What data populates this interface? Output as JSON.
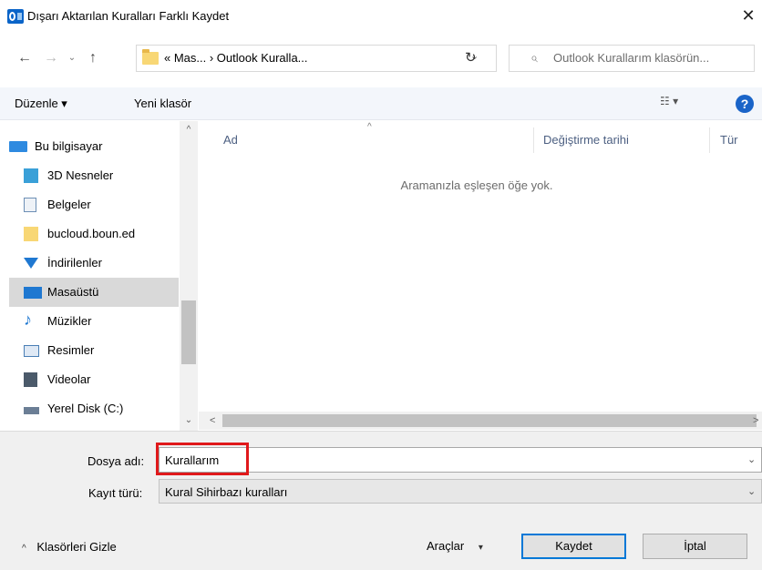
{
  "window": {
    "title": "Dışarı Aktarılan Kuralları Farklı Kaydet",
    "close_glyph": "✕"
  },
  "nav": {
    "back_glyph": "←",
    "forward_glyph": "→",
    "recent_glyph": "⌄",
    "up_glyph": "↑",
    "address": "« Mas...  ›  Outlook Kuralla...",
    "address_dropdown": "⌄",
    "refresh_glyph": "↻",
    "search_glyph": "⌕",
    "search_placeholder": "Outlook Kurallarım klasörün..."
  },
  "toolbar": {
    "organize_label": "Düzenle ▾",
    "new_folder_label": "Yeni klasör",
    "view_glyph": "☷ ▾",
    "help_glyph": "?"
  },
  "sidebar": {
    "items": [
      {
        "label": "Bu bilgisayar",
        "icon": "computer-icon",
        "color": "#2e8ae0"
      },
      {
        "label": "3D Nesneler",
        "icon": "cube-icon",
        "color": "#3aa0d8"
      },
      {
        "label": "Belgeler",
        "icon": "document-icon",
        "color": "#6d8fb5"
      },
      {
        "label": "bucloud.boun.ed",
        "icon": "folder-icon",
        "color": "#f8d775"
      },
      {
        "label": "İndirilenler",
        "icon": "download-icon",
        "color": "#1f78d1"
      },
      {
        "label": "Masaüstü",
        "icon": "desktop-icon",
        "color": "#1f78d1"
      },
      {
        "label": "Müzikler",
        "icon": "music-icon",
        "color": "#1f78d1"
      },
      {
        "label": "Resimler",
        "icon": "pictures-icon",
        "color": "#4a7fb5"
      },
      {
        "label": "Videolar",
        "icon": "film-icon",
        "color": "#4b5a6a"
      },
      {
        "label": "Yerel Disk (C:)",
        "icon": "drive-icon",
        "color": "#6b7e95"
      }
    ],
    "selected": "Masaüstü"
  },
  "list": {
    "columns": [
      "Ad",
      "Değiştirme tarihi",
      "Tür"
    ],
    "empty_message": "Aramanızla eşleşen öğe yok."
  },
  "form": {
    "filename_label": "Dosya adı:",
    "filename_value": "Kurallarım",
    "filetype_label": "Kayıt türü:",
    "filetype_value": "Kural Sihirbazı kuralları",
    "dropdown_glyph": "⌄"
  },
  "footer": {
    "hide_folders_label": "Klasörleri Gizle",
    "hide_chevron": "^",
    "tools_label": "Araçlar",
    "tools_caret": "▾",
    "save_label": "Kaydet",
    "cancel_label": "İptal"
  },
  "colors": {
    "accent": "#0078d7",
    "highlight_box": "#e0191b",
    "toolbar_bg": "#f3f6fb"
  }
}
